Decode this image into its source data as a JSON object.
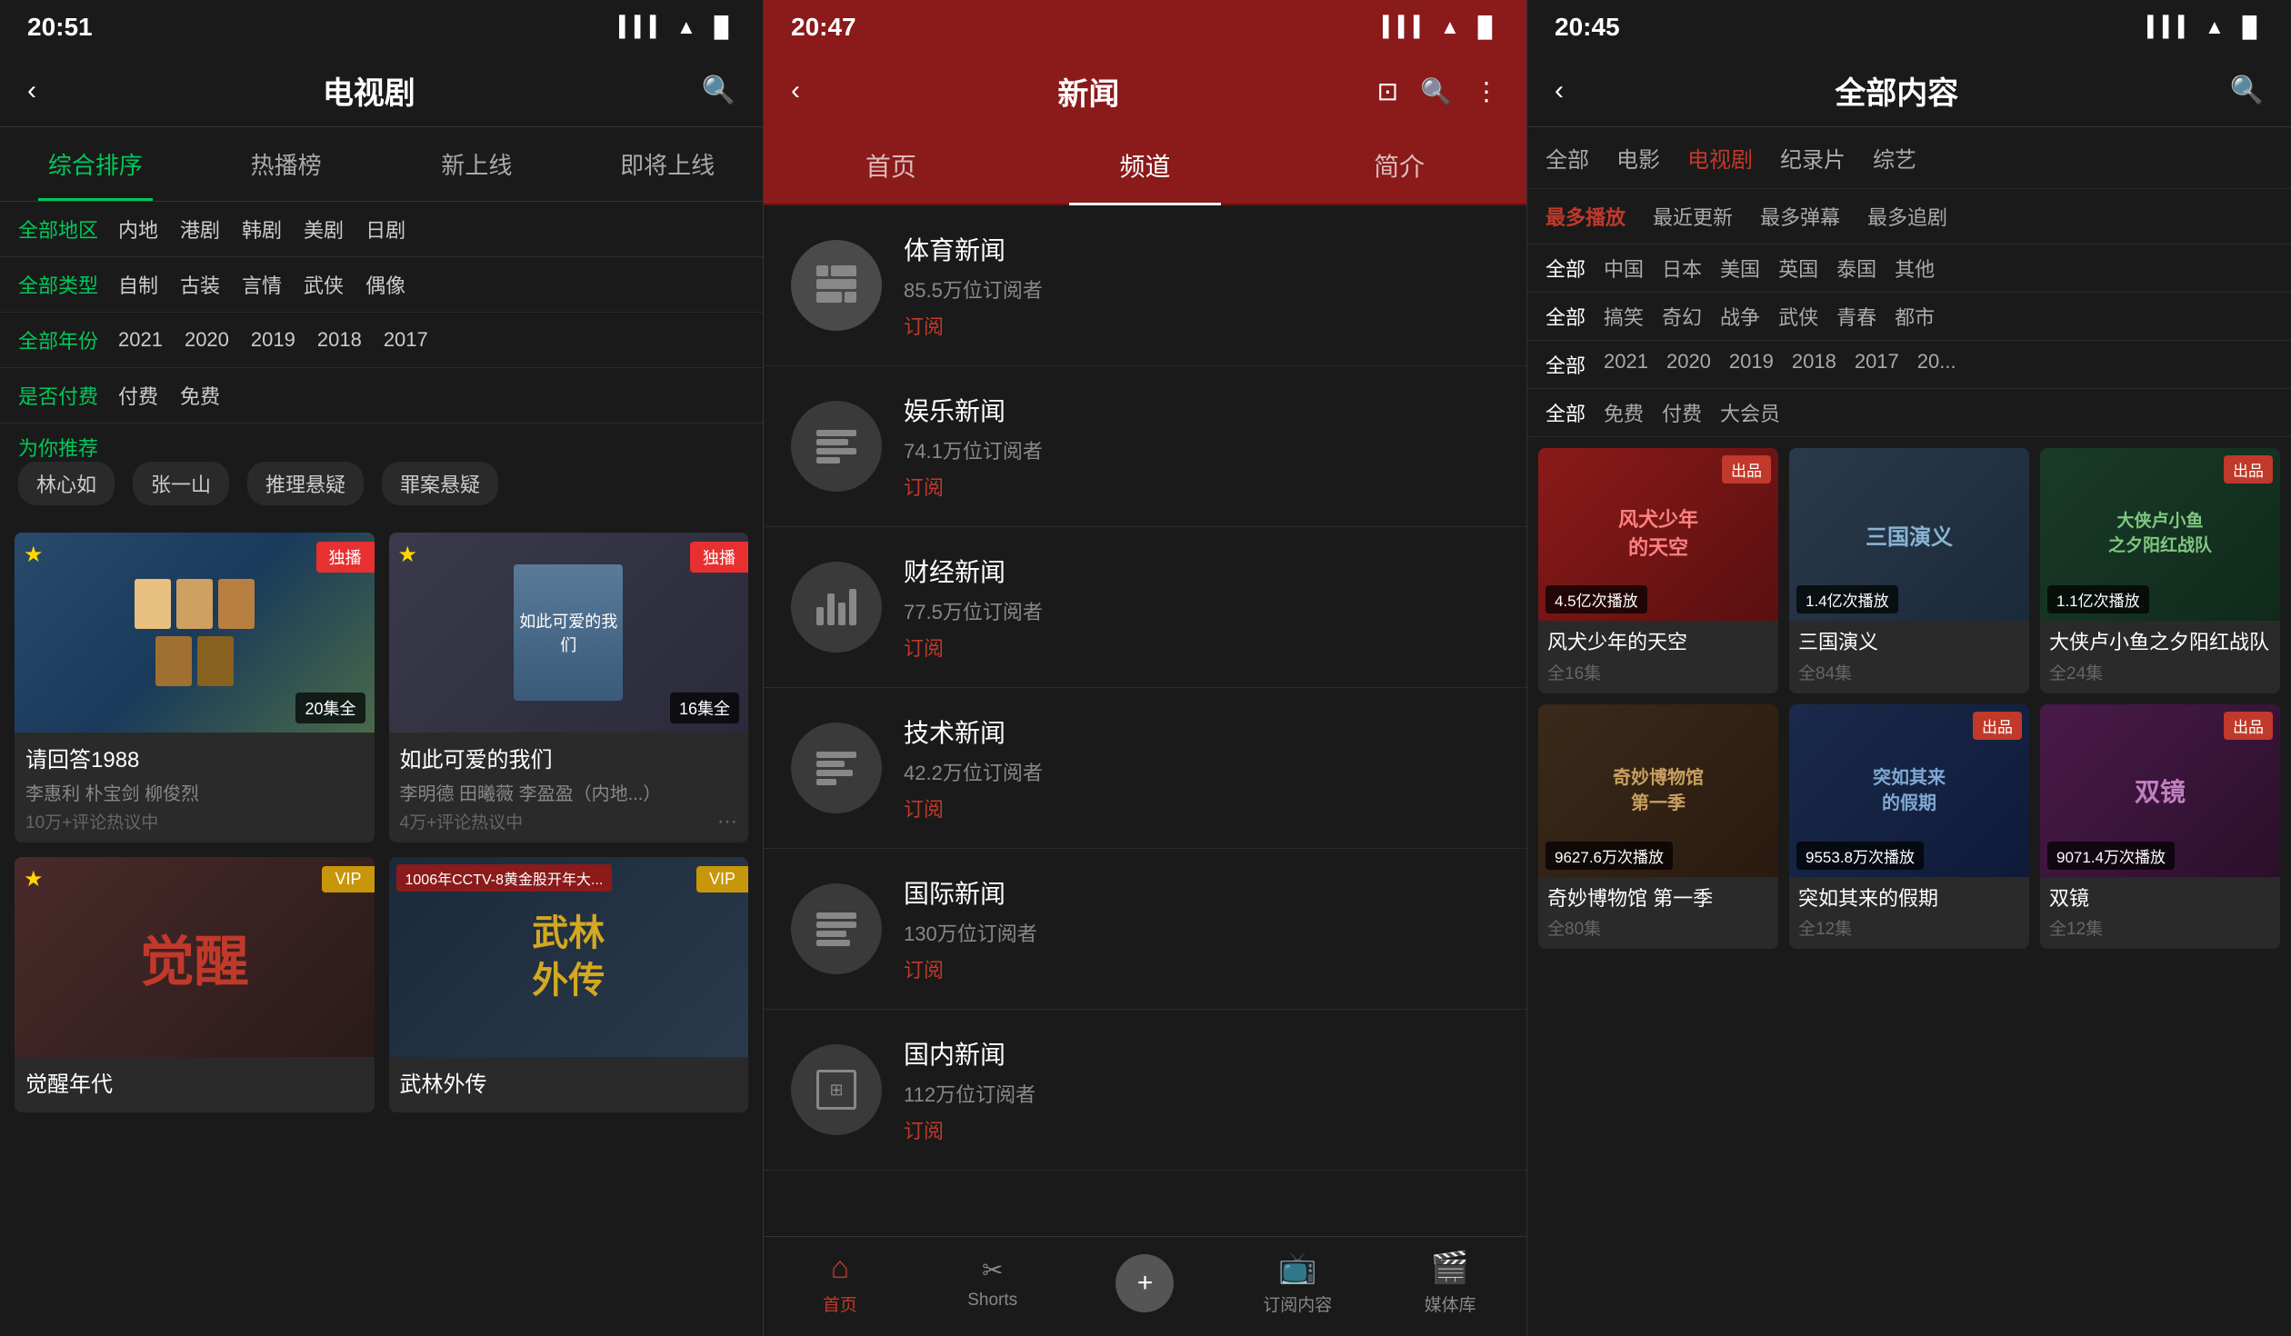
{
  "panel1": {
    "statusTime": "20:51",
    "headerTitle": "电视剧",
    "tabs": [
      "综合排序",
      "热播榜",
      "新上线",
      "即将上线"
    ],
    "activeTab": 0,
    "filters": [
      {
        "label": "全部地区",
        "options": [
          "内地",
          "港剧",
          "韩剧",
          "美剧",
          "日剧"
        ],
        "active": null
      },
      {
        "label": "全部类型",
        "options": [
          "自制",
          "古装",
          "言情",
          "武侠",
          "偶像"
        ],
        "active": null
      },
      {
        "label": "全部年份",
        "options": [
          "2021",
          "2020",
          "2019",
          "2018",
          "2017"
        ],
        "active": null
      },
      {
        "label": "是否付费",
        "options": [
          "付费",
          "免费"
        ],
        "active": null
      }
    ],
    "recommendLabel": "为你推荐",
    "recommendTags": [
      "林心如",
      "张一山",
      "推理悬疑",
      "罪案悬疑"
    ],
    "dramas": [
      {
        "title": "请回答1988",
        "sub": "李惠利 朴宝剑 柳俊烈",
        "comments": "10万+评论热议中",
        "episodes": "20集全",
        "badge": "独播",
        "hasStar": true
      },
      {
        "title": "如此可爱的我们",
        "sub": "李明德 田曦薇 李盈盈（内地...）",
        "comments": "4万+评论热议中",
        "episodes": "16集全",
        "badge": "独播",
        "hasStar": true
      },
      {
        "title": "觉醒年代",
        "sub": "",
        "comments": "",
        "episodes": "",
        "badge": "VIP",
        "hasStar": true
      },
      {
        "title": "武林外传",
        "sub": "",
        "comments": "",
        "episodes": "",
        "badge": "VIP",
        "hasStar": true
      }
    ]
  },
  "panel2": {
    "statusTime": "20:47",
    "headerTitle": "新闻",
    "tabs": [
      "首页",
      "频道",
      "简介"
    ],
    "activeTab": 1,
    "channels": [
      {
        "name": "体育新闻",
        "subscribers": "85.5万位订阅者",
        "subscribeLabel": "订阅",
        "iconType": "sports"
      },
      {
        "name": "娱乐新闻",
        "subscribers": "74.1万位订阅者",
        "subscribeLabel": "订阅",
        "iconType": "entertainment"
      },
      {
        "name": "财经新闻",
        "subscribers": "77.5万位订阅者",
        "subscribeLabel": "订阅",
        "iconType": "finance"
      },
      {
        "name": "技术新闻",
        "subscribers": "42.2万位订阅者",
        "subscribeLabel": "订阅",
        "iconType": "tech"
      },
      {
        "name": "国际新闻",
        "subscribers": "130万位订阅者",
        "subscribeLabel": "订阅",
        "iconType": "international"
      },
      {
        "name": "国内新闻",
        "subscribers": "112万位订阅者",
        "subscribeLabel": "订阅",
        "iconType": "domestic"
      }
    ],
    "bottomNav": [
      {
        "icon": "🏠",
        "label": "首页",
        "active": true
      },
      {
        "icon": "✂️",
        "label": "Shorts",
        "active": false
      },
      {
        "icon": "+",
        "label": "",
        "active": false
      },
      {
        "icon": "📺",
        "label": "订阅内容",
        "active": false
      },
      {
        "icon": "🎬",
        "label": "媒体库",
        "active": false
      }
    ]
  },
  "panel3": {
    "statusTime": "20:45",
    "headerTitle": "全部内容",
    "filterRow": [
      "全部",
      "电影",
      "电视剧",
      "纪录片",
      "综艺"
    ],
    "activeFilter": 2,
    "subFilterRow": [
      "最多播放",
      "最近更新",
      "最多弹幕",
      "最多追剧"
    ],
    "activeSubFilter": 0,
    "tagRows": [
      [
        "全部",
        "中国",
        "日本",
        "美国",
        "英国",
        "泰国",
        "其他"
      ],
      [
        "全部",
        "搞笑",
        "奇幻",
        "战争",
        "武侠",
        "青春",
        "都市"
      ],
      [
        "全部",
        "2021",
        "2020",
        "2019",
        "2018",
        "2017",
        "20..."
      ],
      [
        "全部",
        "免费",
        "付费",
        "大会员"
      ]
    ],
    "cards": [
      {
        "title": "风犬少年的天空",
        "episodes": "全16集",
        "plays": "4.5亿次播放",
        "badge": "",
        "badgeRight": "出品",
        "bg": "p3bg-1"
      },
      {
        "title": "三国演义",
        "episodes": "全84集",
        "plays": "1.4亿次播放",
        "badge": "",
        "badgeRight": "",
        "bg": "p3bg-2"
      },
      {
        "title": "大侠卢小鱼之夕阳红战队",
        "episodes": "全24集",
        "plays": "1.1亿次播放",
        "badge": "",
        "badgeRight": "出品",
        "bg": "p3bg-3"
      },
      {
        "title": "奇妙博物馆 第一季",
        "episodes": "全80集",
        "plays": "9627.6万次播放",
        "badge": "",
        "badgeRight": "",
        "bg": "p3bg-4"
      },
      {
        "title": "突如其来的假期",
        "episodes": "全12集",
        "plays": "9553.8万次播放",
        "badge": "",
        "badgeRight": "出品",
        "bg": "p3bg-5"
      },
      {
        "title": "双镜",
        "episodes": "全12集",
        "plays": "9071.4万次播放",
        "badge": "",
        "badgeRight": "出品",
        "bg": "p3bg-6"
      }
    ]
  }
}
